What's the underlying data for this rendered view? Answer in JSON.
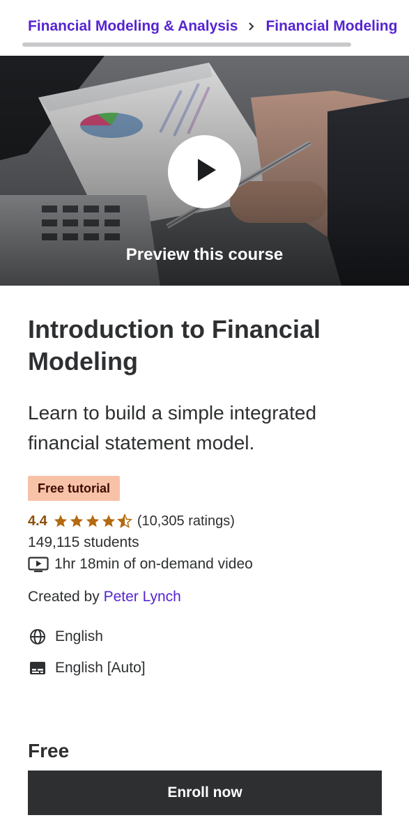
{
  "breadcrumb": {
    "items": [
      "Financial Modeling & Analysis",
      "Financial Modeling"
    ],
    "separator": "›"
  },
  "preview": {
    "label": "Preview this course",
    "icon": "play-icon"
  },
  "course": {
    "title": "Introduction to Financial Modeling",
    "subtitle": "Learn to build a simple integrated financial statement model.",
    "badge": "Free tutorial",
    "rating": "4.4",
    "rating_value": 4.4,
    "ratings_count": "(10,305 ratings)",
    "students": "149,115 students",
    "video": "1hr 18min of on-demand video",
    "created_by_label": "Created by",
    "instructor": "Peter Lynch",
    "language": "English",
    "captions": "English [Auto]",
    "price": "Free",
    "enroll_label": "Enroll now"
  },
  "colors": {
    "link": "#5624d0",
    "text": "#2d2f31",
    "badge_bg": "#f8c2a8",
    "badge_text": "#3d0c02",
    "rating": "#b4690e",
    "button_bg": "#2d2f31"
  }
}
